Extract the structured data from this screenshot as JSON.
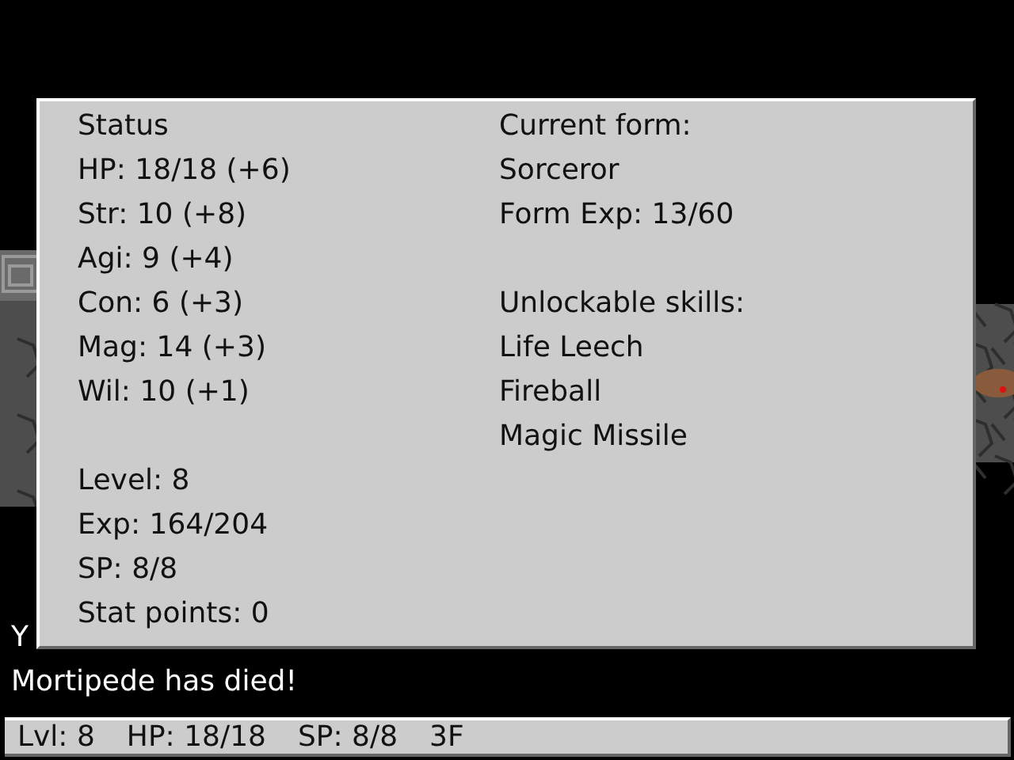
{
  "game_view": {
    "kind": "picture"
  },
  "message_log": [
    "Y",
    "Mortipede has died!"
  ],
  "status_panel": {
    "left_groups": [
      [
        "Status",
        "HP: 18/18 (+6)",
        "Str: 10 (+8)",
        "Agi: 9 (+4)",
        "Con: 6 (+3)",
        "Mag: 14 (+3)",
        "Wil: 10 (+1)"
      ],
      [
        "Level: 8",
        "Exp: 164/204",
        "SP: 8/8",
        "Stat points: 0"
      ]
    ],
    "right_groups": [
      [
        "Current form:",
        "Sorceror",
        "Form Exp: 13/60"
      ],
      [
        "Unlockable skills:",
        "Life Leech",
        "Fireball",
        "Magic Missile"
      ]
    ]
  },
  "status_bar": [
    "Lvl: 8",
    "HP: 18/18",
    "SP: 8/8",
    "3F"
  ]
}
